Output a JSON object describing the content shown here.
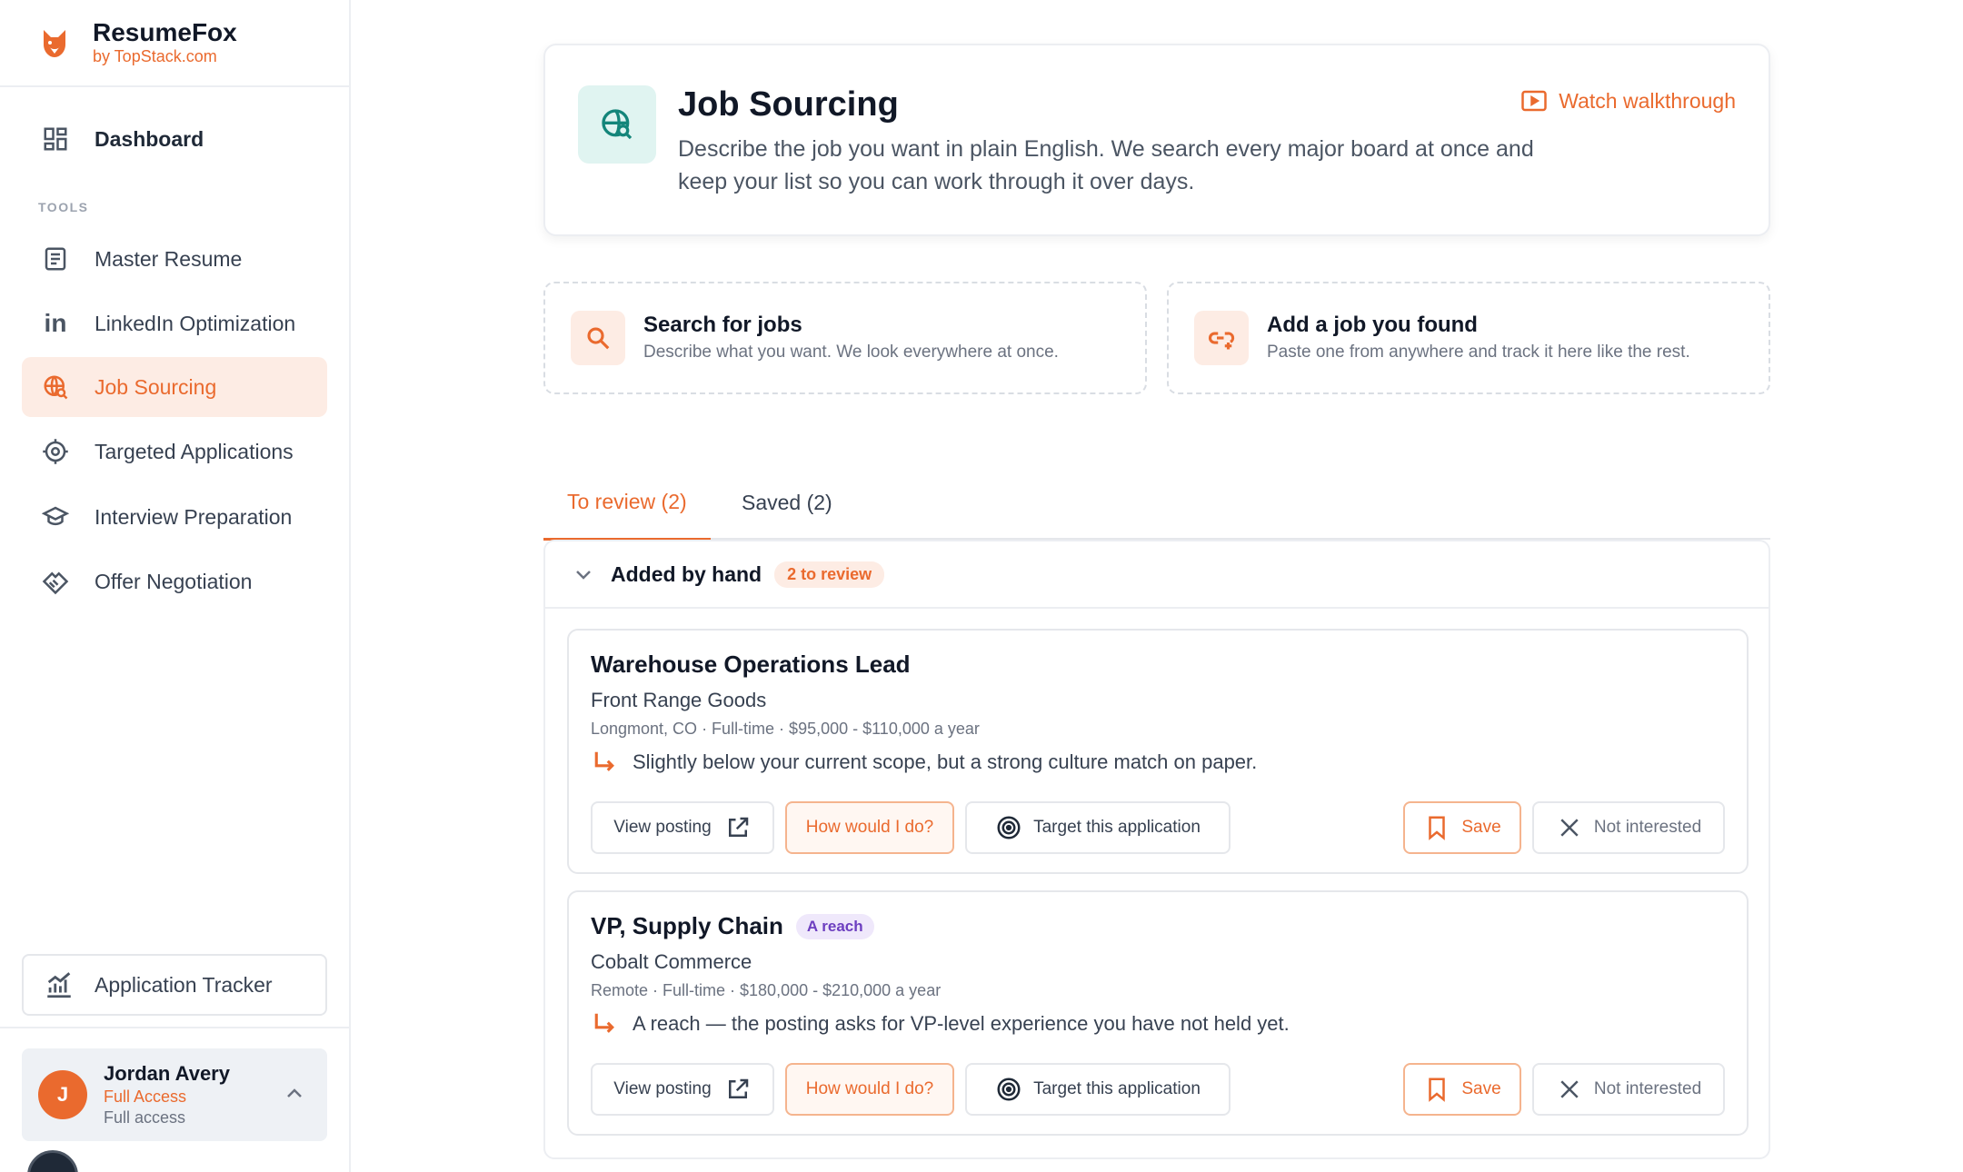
{
  "brand": {
    "name": "ResumeFox",
    "sub": "by TopStack.com"
  },
  "nav": {
    "dashboard": "Dashboard",
    "section": "TOOLS",
    "items": [
      {
        "label": "Master Resume"
      },
      {
        "label": "LinkedIn Optimization"
      },
      {
        "label": "Job Sourcing"
      },
      {
        "label": "Targeted Applications"
      },
      {
        "label": "Interview Preparation"
      },
      {
        "label": "Offer Negotiation"
      }
    ],
    "tracker": "Application Tracker"
  },
  "user": {
    "initial": "J",
    "name": "Jordan Avery",
    "plan": "Full Access",
    "plan_detail": "Full access"
  },
  "page": {
    "title": "Job Sourcing",
    "description": "Describe the job you want in plain English. We search every major board at once and keep your list so you can work through it over days.",
    "walkthrough": "Watch walkthrough"
  },
  "actions": [
    {
      "title": "Search for jobs",
      "sub": "Describe what you want. We look everywhere at once."
    },
    {
      "title": "Add a job you found",
      "sub": "Paste one from anywhere and track it here like the rest."
    }
  ],
  "tabs": [
    {
      "label": "To review (2)"
    },
    {
      "label": "Saved (2)"
    }
  ],
  "group": {
    "title": "Added by hand",
    "badge": "2 to review"
  },
  "buttons": {
    "view": "View posting",
    "how": "How would I do?",
    "target": "Target this application",
    "save": "Save",
    "not_interested": "Not interested"
  },
  "jobs": [
    {
      "title": "Warehouse Operations Lead",
      "company": "Front Range Goods",
      "meta": "Longmont, CO · Full-time · $95,000 - $110,000 a year",
      "note": "Slightly below your current scope, but a strong culture match on paper.",
      "tag": ""
    },
    {
      "title": "VP, Supply Chain",
      "company": "Cobalt Commerce",
      "meta": "Remote · Full-time · $180,000 - $210,000 a year",
      "note": "A reach — the posting asks for VP-level experience you have not held yet.",
      "tag": "A reach"
    }
  ],
  "colors": {
    "accent": "#ea6a2e",
    "teal": "#14857a",
    "purple": "#6d3fc0"
  }
}
